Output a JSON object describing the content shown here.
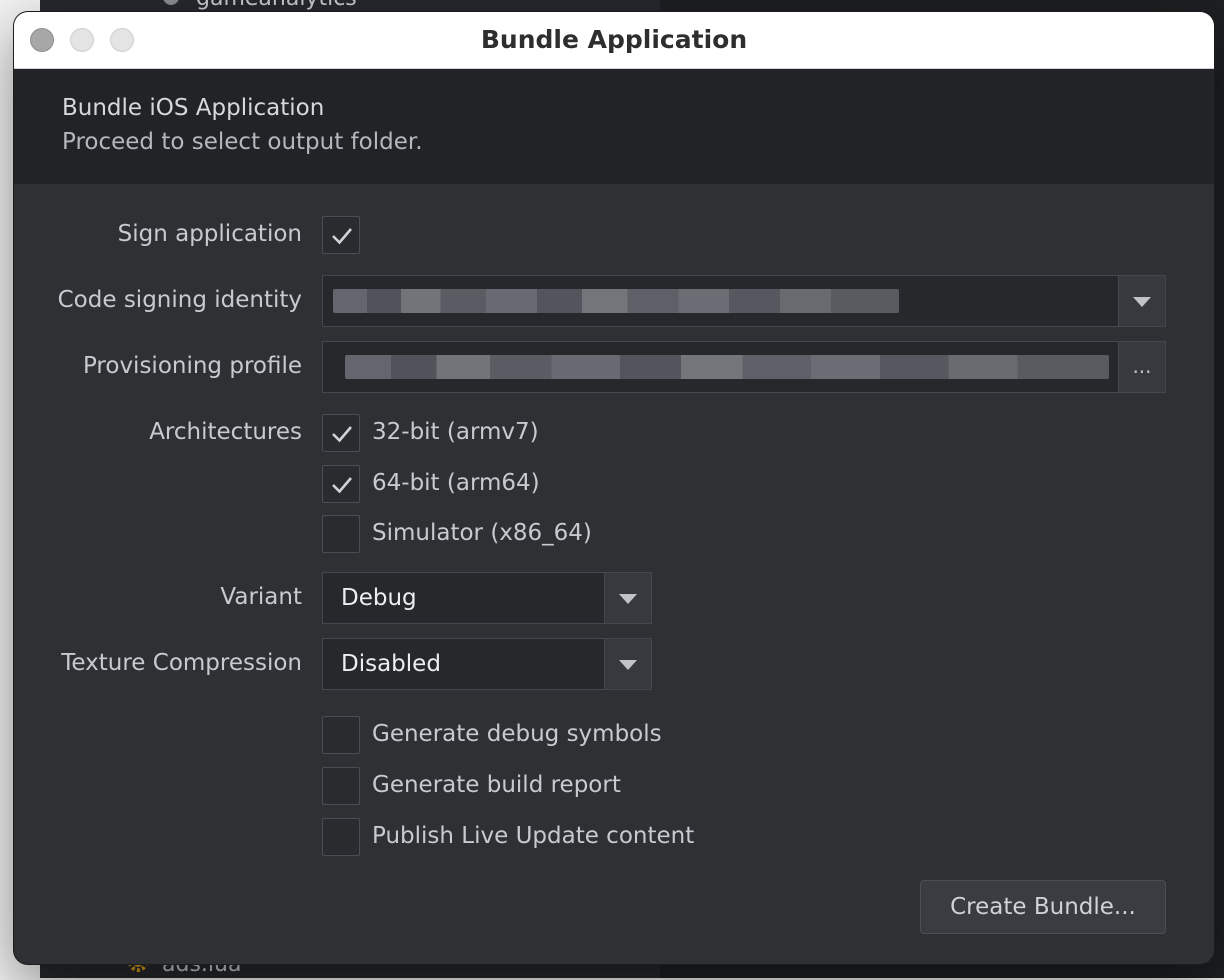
{
  "background": {
    "items": [
      {
        "label": "gameanalytics"
      },
      {
        "label": "ads.lua"
      }
    ]
  },
  "window": {
    "title": "Bundle Application"
  },
  "header": {
    "title": "Bundle iOS Application",
    "subtitle": "Proceed to select output folder."
  },
  "form": {
    "sign_application": {
      "label": "Sign application",
      "checked": true
    },
    "code_signing_identity": {
      "label": "Code signing identity",
      "value_redacted": true
    },
    "provisioning_profile": {
      "label": "Provisioning profile",
      "value_redacted": true,
      "browse_label": "..."
    },
    "architectures": {
      "label": "Architectures",
      "options": [
        {
          "label": "32-bit (armv7)",
          "checked": true
        },
        {
          "label": "64-bit (arm64)",
          "checked": true
        },
        {
          "label": "Simulator (x86_64)",
          "checked": false
        }
      ]
    },
    "variant": {
      "label": "Variant",
      "value": "Debug"
    },
    "texture_compression": {
      "label": "Texture Compression",
      "value": "Disabled"
    },
    "options": [
      {
        "label": "Generate debug symbols",
        "checked": false
      },
      {
        "label": "Generate build report",
        "checked": false
      },
      {
        "label": "Publish Live Update content",
        "checked": false
      }
    ]
  },
  "actions": {
    "create_bundle_label": "Create Bundle..."
  },
  "colors": {
    "dialog_bg": "#2e3034",
    "header_bg": "#212327",
    "titlebar_bg": "#ffffff",
    "icon_gold": "#d4a017"
  },
  "icons": [
    "gear-icon",
    "checkmark-icon",
    "dropdown-arrow-icon"
  ]
}
